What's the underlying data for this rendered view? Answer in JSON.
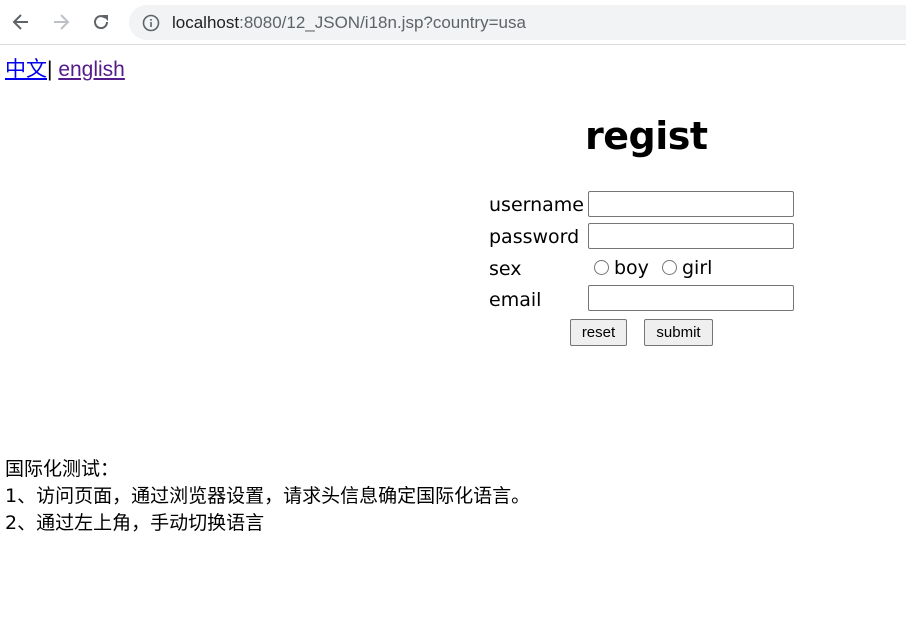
{
  "browser": {
    "url_host": "localhost",
    "url_rest": ":8080/12_JSON/i18n.jsp?country=usa"
  },
  "lang_links": {
    "zh": "中文",
    "separator": "|",
    "en": "english"
  },
  "form": {
    "title": "regist",
    "username_label": "username",
    "password_label": "password",
    "sex_label": "sex",
    "boy_label": "boy",
    "girl_label": "girl",
    "email_label": "email",
    "reset_label": "reset",
    "submit_label": "submit"
  },
  "notes": {
    "heading": "国际化测试：",
    "line1": "1、访问页面，通过浏览器设置，请求头信息确定国际化语言。",
    "line2": "2、通过左上角，手动切换语言"
  },
  "icons": {
    "back": "arrow-left-icon",
    "forward": "arrow-right-icon",
    "reload": "reload-icon",
    "info": "info-icon"
  }
}
